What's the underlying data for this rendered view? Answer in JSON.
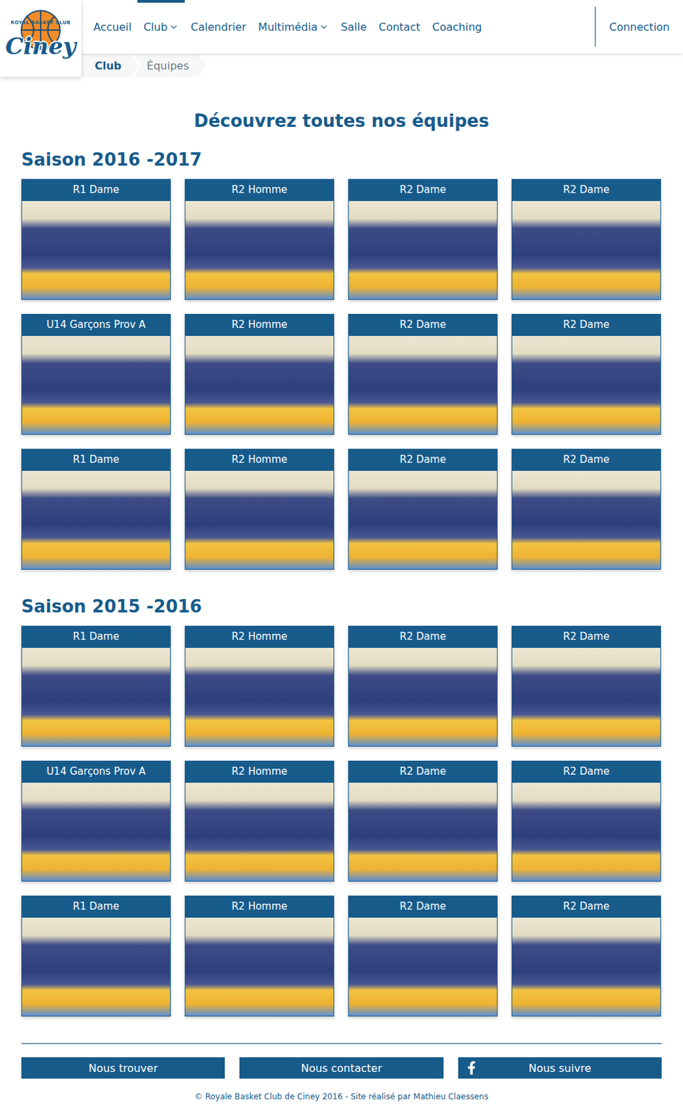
{
  "logo": {
    "top": "ROYAL BASKET CLUB",
    "name": "Ciney"
  },
  "nav": [
    {
      "label": "Accueil",
      "selected": false,
      "dropdown": false
    },
    {
      "label": "Club",
      "selected": true,
      "dropdown": true
    },
    {
      "label": "Calendrier",
      "selected": false,
      "dropdown": false
    },
    {
      "label": "Multimédia",
      "selected": false,
      "dropdown": true
    },
    {
      "label": "Salle",
      "selected": false,
      "dropdown": false
    },
    {
      "label": "Contact",
      "selected": false,
      "dropdown": false
    },
    {
      "label": "Coaching",
      "selected": false,
      "dropdown": false
    }
  ],
  "account": {
    "label": "Connection"
  },
  "breadcrumb": [
    {
      "label": "Club",
      "selected": false
    },
    {
      "label": "Équipes",
      "selected": true
    }
  ],
  "page_title": "Découvrez toutes nos équipes",
  "seasons": [
    {
      "title": "Saison 2016 -2017",
      "teams": [
        "R1 Dame",
        "R2 Homme",
        "R2 Dame",
        "R2 Dame",
        "U14 Garçons Prov A",
        "R2 Homme",
        "R2 Dame",
        "R2 Dame",
        "R1 Dame",
        "R2 Homme",
        "R2 Dame",
        "R2 Dame"
      ]
    },
    {
      "title": "Saison 2015 -2016",
      "teams": [
        "R1 Dame",
        "R2 Homme",
        "R2 Dame",
        "R2 Dame",
        "U14 Garçons Prov A",
        "R2 Homme",
        "R2 Dame",
        "R2 Dame",
        "R1 Dame",
        "R2 Homme",
        "R2 Dame",
        "R2 Dame"
      ]
    }
  ],
  "footer": {
    "buttons": [
      {
        "label": "Nous trouver",
        "kind": "plain"
      },
      {
        "label": "Nous contacter",
        "kind": "plain"
      },
      {
        "label": "Nous suivre",
        "kind": "facebook"
      }
    ],
    "copyright": "© Royale Basket Club de Ciney 2016 - Site réalisé par Mathieu Claessens"
  }
}
